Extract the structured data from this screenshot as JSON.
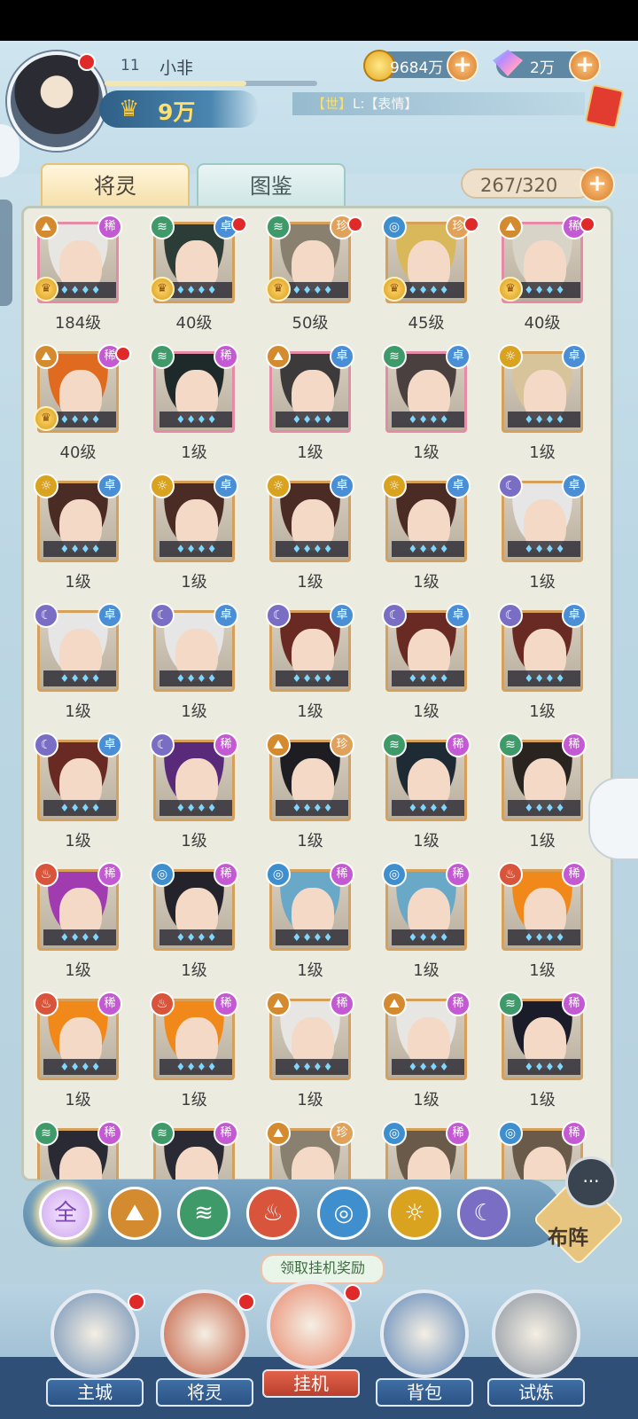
{
  "player": {
    "level": "11",
    "name": "小非",
    "power": "9万"
  },
  "currency": {
    "gold": "9684万",
    "gems": "2万"
  },
  "chat": {
    "tag": "【世】",
    "text": "L:【表情】"
  },
  "tabs": [
    {
      "label": "将灵",
      "active": true
    },
    {
      "label": "图鉴",
      "active": false
    }
  ],
  "capacity": "267/320",
  "cards": [
    {
      "element": "mountain",
      "rarity": "稀",
      "level": "184级",
      "crest": true,
      "dot": false,
      "hair": "#e8e6e2"
    },
    {
      "element": "wind",
      "rarity": "卓",
      "level": "40级",
      "crest": true,
      "dot": true,
      "hair": "#2c3c36"
    },
    {
      "element": "wind",
      "rarity": "珍",
      "level": "50级",
      "crest": true,
      "dot": true,
      "hair": "#8a8070"
    },
    {
      "element": "water",
      "rarity": "珍",
      "level": "45级",
      "crest": true,
      "dot": true,
      "hair": "#d8b85a"
    },
    {
      "element": "mountain",
      "rarity": "稀",
      "level": "40级",
      "crest": true,
      "dot": true,
      "hair": "#d9d4c8"
    },
    {
      "element": "mountain",
      "rarity": "稀",
      "level": "40级",
      "crest": true,
      "dot": true,
      "hair": "#e06a20"
    },
    {
      "element": "wind",
      "rarity": "稀",
      "level": "1级",
      "crest": false,
      "dot": false,
      "hair": "#1e2a2a"
    },
    {
      "element": "mountain",
      "rarity": "卓",
      "level": "1级",
      "crest": false,
      "dot": false,
      "hair": "#3c3a3a"
    },
    {
      "element": "wind",
      "rarity": "卓",
      "level": "1级",
      "crest": false,
      "dot": false,
      "hair": "#4a4040"
    },
    {
      "element": "sun",
      "rarity": "卓",
      "level": "1级",
      "crest": false,
      "dot": false,
      "hair": "#d8c49a"
    },
    {
      "element": "sun",
      "rarity": "卓",
      "level": "1级",
      "crest": false,
      "dot": false,
      "hair": "#4a2c24"
    },
    {
      "element": "sun",
      "rarity": "卓",
      "level": "1级",
      "crest": false,
      "dot": false,
      "hair": "#4a2c24"
    },
    {
      "element": "sun",
      "rarity": "卓",
      "level": "1级",
      "crest": false,
      "dot": false,
      "hair": "#4a2c24"
    },
    {
      "element": "sun",
      "rarity": "卓",
      "level": "1级",
      "crest": false,
      "dot": false,
      "hair": "#4a2c24"
    },
    {
      "element": "moon",
      "rarity": "卓",
      "level": "1级",
      "crest": false,
      "dot": false,
      "hair": "#e6e6e6"
    },
    {
      "element": "moon",
      "rarity": "卓",
      "level": "1级",
      "crest": false,
      "dot": false,
      "hair": "#e6e6e6"
    },
    {
      "element": "moon",
      "rarity": "卓",
      "level": "1级",
      "crest": false,
      "dot": false,
      "hair": "#e6e6e6"
    },
    {
      "element": "moon",
      "rarity": "卓",
      "level": "1级",
      "crest": false,
      "dot": false,
      "hair": "#6a2a24"
    },
    {
      "element": "moon",
      "rarity": "卓",
      "level": "1级",
      "crest": false,
      "dot": false,
      "hair": "#6a2a24"
    },
    {
      "element": "moon",
      "rarity": "卓",
      "level": "1级",
      "crest": false,
      "dot": false,
      "hair": "#6a2a24"
    },
    {
      "element": "moon",
      "rarity": "卓",
      "level": "1级",
      "crest": false,
      "dot": false,
      "hair": "#6a2a24"
    },
    {
      "element": "moon",
      "rarity": "稀",
      "level": "1级",
      "crest": false,
      "dot": false,
      "hair": "#5a2a7a"
    },
    {
      "element": "mountain",
      "rarity": "珍",
      "level": "1级",
      "crest": false,
      "dot": false,
      "hair": "#1e1e22"
    },
    {
      "element": "wind",
      "rarity": "稀",
      "level": "1级",
      "crest": false,
      "dot": false,
      "hair": "#1e2a34"
    },
    {
      "element": "wind",
      "rarity": "稀",
      "level": "1级",
      "crest": false,
      "dot": false,
      "hair": "#2a2420"
    },
    {
      "element": "fire",
      "rarity": "稀",
      "level": "1级",
      "crest": false,
      "dot": false,
      "hair": "#a03cb0"
    },
    {
      "element": "water",
      "rarity": "稀",
      "level": "1级",
      "crest": false,
      "dot": false,
      "hair": "#24222a"
    },
    {
      "element": "water",
      "rarity": "稀",
      "level": "1级",
      "crest": false,
      "dot": false,
      "hair": "#6aa8c8"
    },
    {
      "element": "water",
      "rarity": "稀",
      "level": "1级",
      "crest": false,
      "dot": false,
      "hair": "#6aa8c8"
    },
    {
      "element": "fire",
      "rarity": "稀",
      "level": "1级",
      "crest": false,
      "dot": false,
      "hair": "#f0891a"
    },
    {
      "element": "fire",
      "rarity": "稀",
      "level": "1级",
      "crest": false,
      "dot": false,
      "hair": "#f0891a"
    },
    {
      "element": "fire",
      "rarity": "稀",
      "level": "1级",
      "crest": false,
      "dot": false,
      "hair": "#f0891a"
    },
    {
      "element": "mountain",
      "rarity": "稀",
      "level": "1级",
      "crest": false,
      "dot": false,
      "hair": "#e8e6e2"
    },
    {
      "element": "mountain",
      "rarity": "稀",
      "level": "1级",
      "crest": false,
      "dot": false,
      "hair": "#e8e6e2"
    },
    {
      "element": "wind",
      "rarity": "稀",
      "level": "1级",
      "crest": false,
      "dot": false,
      "hair": "#1a1c2a"
    },
    {
      "element": "wind",
      "rarity": "稀",
      "level": "",
      "crest": false,
      "dot": false,
      "hair": "#2a2a34"
    },
    {
      "element": "wind",
      "rarity": "稀",
      "level": "",
      "crest": false,
      "dot": false,
      "hair": "#2a2a34"
    },
    {
      "element": "mountain",
      "rarity": "珍",
      "level": "",
      "crest": false,
      "dot": false,
      "hair": "#8a8070"
    },
    {
      "element": "water",
      "rarity": "稀",
      "level": "",
      "crest": false,
      "dot": false,
      "hair": "#6a5a4a"
    },
    {
      "element": "water",
      "rarity": "稀",
      "level": "",
      "crest": false,
      "dot": false,
      "hair": "#6a5a4a"
    }
  ],
  "element_icons": {
    "mountain": "⛰",
    "wind": "≋",
    "water": "◎",
    "sun": "☼",
    "moon": "☾",
    "fire": "♨"
  },
  "filters": [
    {
      "name": "all",
      "label": "全"
    },
    {
      "name": "mountain",
      "label": "⛰"
    },
    {
      "name": "wind",
      "label": "≋"
    },
    {
      "name": "fire",
      "label": "♨"
    },
    {
      "name": "water",
      "label": "◎"
    },
    {
      "name": "sun",
      "label": "☼"
    },
    {
      "name": "moon",
      "label": "☾"
    }
  ],
  "formation_label": "布阵",
  "claim_reward": "领取挂机奖励",
  "nav": [
    {
      "label": "主城",
      "active": false,
      "dot": true
    },
    {
      "label": "将灵",
      "active": false,
      "dot": true
    },
    {
      "label": "挂机",
      "active": true,
      "dot": true
    },
    {
      "label": "背包",
      "active": false,
      "dot": false
    },
    {
      "label": "试炼",
      "active": false,
      "dot": false
    }
  ],
  "colors": {
    "xi": "#c45ad3",
    "zhuo": "#4a8fd6",
    "zhen": "#e0a25a",
    "accent": "#f5c842"
  }
}
